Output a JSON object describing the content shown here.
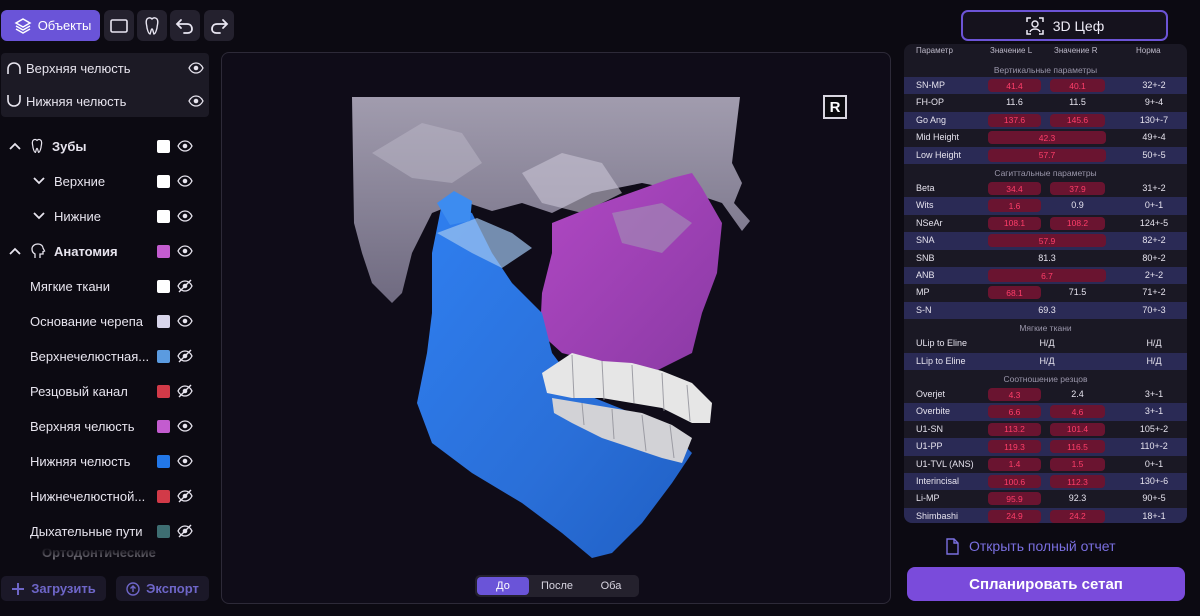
{
  "toolbar": {
    "objects_label": "Объекты",
    "cef_label": "3D Цеф"
  },
  "left_panel": {
    "upper_jaw": "Верхняя челюсть",
    "lower_jaw": "Нижняя челюсть",
    "teeth": "Зубы",
    "teeth_upper": "Верхние",
    "teeth_lower": "Нижние",
    "anatomy": "Анатомия",
    "anatomy_items": [
      {
        "label": "Мягкие ткани",
        "color": "#ffffff",
        "visible": false
      },
      {
        "label": "Основание черепа",
        "color": "#d8d5ea",
        "visible": true
      },
      {
        "label": "Верхнечелюстная...",
        "color": "#5b9be0",
        "visible": false
      },
      {
        "label": "Резцовый канал",
        "color": "#d23a48",
        "visible": false
      },
      {
        "label": "Верхняя челюсть",
        "color": "#c35ccf",
        "visible": true
      },
      {
        "label": "Нижняя челюсть",
        "color": "#2277e8",
        "visible": true
      },
      {
        "label": "Нижнечелюстной...",
        "color": "#d23a48",
        "visible": false
      },
      {
        "label": "Дыхательные пути",
        "color": "#3e6e72",
        "visible": false
      }
    ],
    "ortho": "Ортодонтические",
    "load_button": "Загрузить",
    "export_button": "Экспорт"
  },
  "viewport": {
    "orientation_badge": "R",
    "seg_before": "До",
    "seg_after": "После",
    "seg_both": "Оба",
    "seg_selected": "До"
  },
  "table": {
    "headers": [
      "Параметр",
      "Значение L",
      "Значение R",
      "Норма"
    ],
    "sections": [
      {
        "title": "Вертикальные параметры",
        "rows": [
          {
            "p": "SN-MP",
            "l": "41.4",
            "r": "40.1",
            "n": "32+-2",
            "hl": true,
            "hr": true
          },
          {
            "p": "FH-OP",
            "l": "11.6",
            "r": "11.5",
            "n": "9+-4"
          },
          {
            "p": "Go Ang",
            "l": "137.6",
            "r": "145.6",
            "n": "130+-7",
            "hl": true,
            "hr": true
          },
          {
            "p": "Mid Height",
            "m": "42.3",
            "n": "49+-4",
            "hm": true
          },
          {
            "p": "Low Height",
            "m": "57.7",
            "n": "50+-5",
            "hm": true
          }
        ]
      },
      {
        "title": "Сагиттальные параметры",
        "rows": [
          {
            "p": "Beta",
            "l": "34.4",
            "r": "37.9",
            "n": "31+-2",
            "hl": true,
            "hr": true
          },
          {
            "p": "Wits",
            "l": "1.6",
            "r": "0.9",
            "n": "0+-1",
            "hl": true
          },
          {
            "p": "NSeAr",
            "l": "108.1",
            "r": "108.2",
            "n": "124+-5",
            "hl": true,
            "hr": true
          },
          {
            "p": "SNA",
            "m": "57.9",
            "n": "82+-2",
            "hm": true
          },
          {
            "p": "SNB",
            "m": "81.3",
            "n": "80+-2"
          },
          {
            "p": "ANB",
            "m": "6.7",
            "n": "2+-2",
            "hm": true
          },
          {
            "p": "MP",
            "l": "68.1",
            "r": "71.5",
            "n": "71+-2",
            "hl": true
          },
          {
            "p": "S-N",
            "m": "69.3",
            "n": "70+-3"
          }
        ]
      },
      {
        "title": "Мягкие ткани",
        "rows": [
          {
            "p": "ULip to Eline",
            "m": "Н/Д",
            "n": "Н/Д"
          },
          {
            "p": "LLip to Eline",
            "m": "Н/Д",
            "n": "Н/Д"
          }
        ]
      },
      {
        "title": "Соотношение резцов",
        "rows": [
          {
            "p": "Overjet",
            "l": "4.3",
            "r": "2.4",
            "n": "3+-1",
            "hl": true
          },
          {
            "p": "Overbite",
            "l": "6.6",
            "r": "4.6",
            "n": "3+-1",
            "hl": true,
            "hr": true
          },
          {
            "p": "U1-SN",
            "l": "113.2",
            "r": "101.4",
            "n": "105+-2",
            "hl": true,
            "hr": true
          },
          {
            "p": "U1-PP",
            "l": "119.3",
            "r": "116.5",
            "n": "110+-2",
            "hl": true,
            "hr": true
          },
          {
            "p": "U1-TVL (ANS)",
            "l": "1.4",
            "r": "1.5",
            "n": "0+-1",
            "hl": true,
            "hr": true
          },
          {
            "p": "Interincisal",
            "l": "100.6",
            "r": "112.3",
            "n": "130+-6",
            "hl": true,
            "hr": true
          },
          {
            "p": "Li-MP",
            "l": "95.9",
            "r": "92.3",
            "n": "90+-5",
            "hl": true
          },
          {
            "p": "Shimbashi",
            "l": "24.9",
            "r": "24.2",
            "n": "18+-1",
            "hl": true,
            "hr": true
          }
        ]
      }
    ]
  },
  "open_report": "Открыть полный отчет",
  "plan_button": "Спланировать сетап",
  "colors": {
    "accent": "#6a54d8",
    "plan": "#7a4bdb",
    "danger": "#ff3e6a"
  }
}
